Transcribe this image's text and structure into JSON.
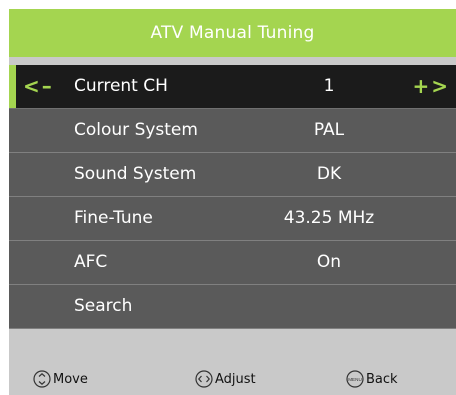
{
  "menu": {
    "title": "ATV Manual Tuning",
    "rows": [
      {
        "label": "Current CH",
        "value": "1",
        "decrease": "<–",
        "increase": "+>"
      },
      {
        "label": "Colour System",
        "value": "PAL"
      },
      {
        "label": "Sound System",
        "value": "DK"
      },
      {
        "label": "Fine-Tune",
        "value": "43.25 MHz"
      },
      {
        "label": "AFC",
        "value": "On"
      },
      {
        "label": "Search",
        "value": ""
      }
    ]
  },
  "footer": {
    "move_label": "Move",
    "adjust_label": "Adjust",
    "menu_icon_text": "MENU",
    "back_label": "Back"
  },
  "colors": {
    "accent": "#a4d550",
    "row": "#5a5a5a",
    "selected_row": "#1b1b1b",
    "footer_bg": "#c9c9c9"
  },
  "icons": {
    "move": "up-down-circle-icon",
    "adjust": "left-right-circle-icon",
    "back": "menu-button-icon"
  }
}
